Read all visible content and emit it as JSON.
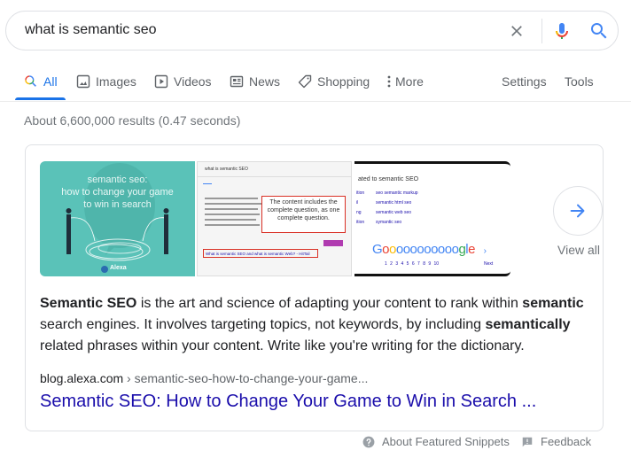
{
  "search": {
    "query": "what is semantic seo",
    "clear_icon": "close-icon",
    "mic_icon": "microphone-icon",
    "search_icon": "search-icon"
  },
  "tabs": {
    "items": [
      {
        "label": "All",
        "icon": "search-icon",
        "active": true
      },
      {
        "label": "Images",
        "icon": "image-icon"
      },
      {
        "label": "Videos",
        "icon": "play-icon"
      },
      {
        "label": "News",
        "icon": "newspaper-icon"
      },
      {
        "label": "Shopping",
        "icon": "tag-icon"
      },
      {
        "label": "More",
        "icon": "more-vert-icon"
      }
    ],
    "settings": "Settings",
    "tools": "Tools"
  },
  "result_stats": "About 6,600,000 results (0.47 seconds)",
  "featured": {
    "images": [
      {
        "title_lines": [
          "semantic seo:",
          "how to change your game",
          "to win in search"
        ],
        "brand": "Alexa"
      },
      {
        "query": "what is semantic SEO",
        "callout": "The content includes the complete question, as one complete question.",
        "link": "What is semantic SEO and what is semantic Web? - HitTail"
      },
      {
        "heading": "ated to semantic SEO",
        "related": [
          "seo semantic markup",
          "semantic html seo",
          "semantic web seo",
          "symantic seo"
        ],
        "logo": "Goooooooooogle",
        "pages": "1 2 3 4 5 6 7 8 9 10",
        "next": "Next"
      }
    ],
    "view_all": "View all",
    "snippet": {
      "b1": "Semantic SEO",
      "t1": " is the art and science of adapting your content to rank within ",
      "b2": "semantic",
      "t2": " search engines. It involves targeting topics, not keywords, by including ",
      "b3": "semantically",
      "t3": " related phrases within your content. Write like you're writing for the dictionary."
    },
    "cite_domain": "blog.alexa.com",
    "cite_path": " › semantic-seo-how-to-change-your-game...",
    "title": "Semantic SEO: How to Change Your Game to Win in Search ..."
  },
  "footer": {
    "about": "About Featured Snippets",
    "feedback": "Feedback"
  },
  "colors": {
    "accent": "#1a73e8",
    "link": "#1a0dab",
    "muted": "#70757a"
  }
}
